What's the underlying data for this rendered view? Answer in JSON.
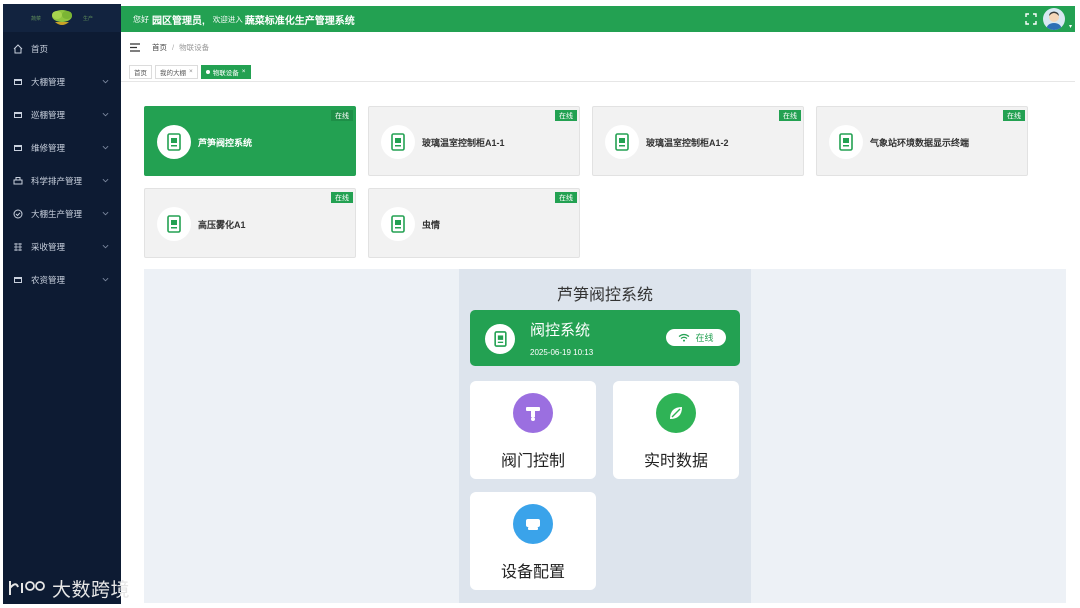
{
  "colors": {
    "accent": "#23a152",
    "sidebar": "#0d1b33",
    "panel": "#dde4ed"
  },
  "logo": {
    "left_tag": "蔬菜",
    "right_tag": "生产"
  },
  "sidebar": {
    "items": [
      {
        "label": "首页",
        "icon": "home-icon"
      },
      {
        "label": "大棚管理",
        "icon": "card-icon"
      },
      {
        "label": "巡棚管理",
        "icon": "card-icon"
      },
      {
        "label": "维修管理",
        "icon": "card-icon"
      },
      {
        "label": "科学排产管理",
        "icon": "printer-icon"
      },
      {
        "label": "大棚生产管理",
        "icon": "badge-icon"
      },
      {
        "label": "采收管理",
        "icon": "grid-icon"
      },
      {
        "label": "农资管理",
        "icon": "card-icon"
      }
    ]
  },
  "topbar": {
    "hello": "您好",
    "role": "园区管理员,",
    "welcome": "欢迎进入",
    "system_name": "蔬菜标准化生产管理系统"
  },
  "breadcrumb": {
    "home": "首页",
    "separator": "/",
    "current": "物联设备"
  },
  "tabs": [
    {
      "label": "首页"
    },
    {
      "label": "我的大棚"
    },
    {
      "label": "物联设备"
    }
  ],
  "devices": [
    {
      "name": "芦笋阀控系统",
      "status": "在线"
    },
    {
      "name": "玻璃温室控制柜A1-1",
      "status": "在线"
    },
    {
      "name": "玻璃温室控制柜A1-2",
      "status": "在线"
    },
    {
      "name": "气象站环境数据显示终端",
      "status": "在线"
    },
    {
      "name": "高压雾化A1",
      "status": "在线"
    },
    {
      "name": "虫情",
      "status": "在线"
    }
  ],
  "detail": {
    "title": "芦笋阀控系统",
    "system_name": "阀控系统",
    "time": "2025-06-19 10:13",
    "status": "在线",
    "functions": [
      {
        "label": "阀门控制",
        "icon": "valve-icon",
        "color": "#9b6fe0"
      },
      {
        "label": "实时数据",
        "icon": "data-leaf-icon",
        "color": "#2fb356"
      },
      {
        "label": "设备配置",
        "icon": "config-icon",
        "color": "#3aa3ea"
      }
    ]
  },
  "watermark": {
    "text": "大数跨境"
  }
}
